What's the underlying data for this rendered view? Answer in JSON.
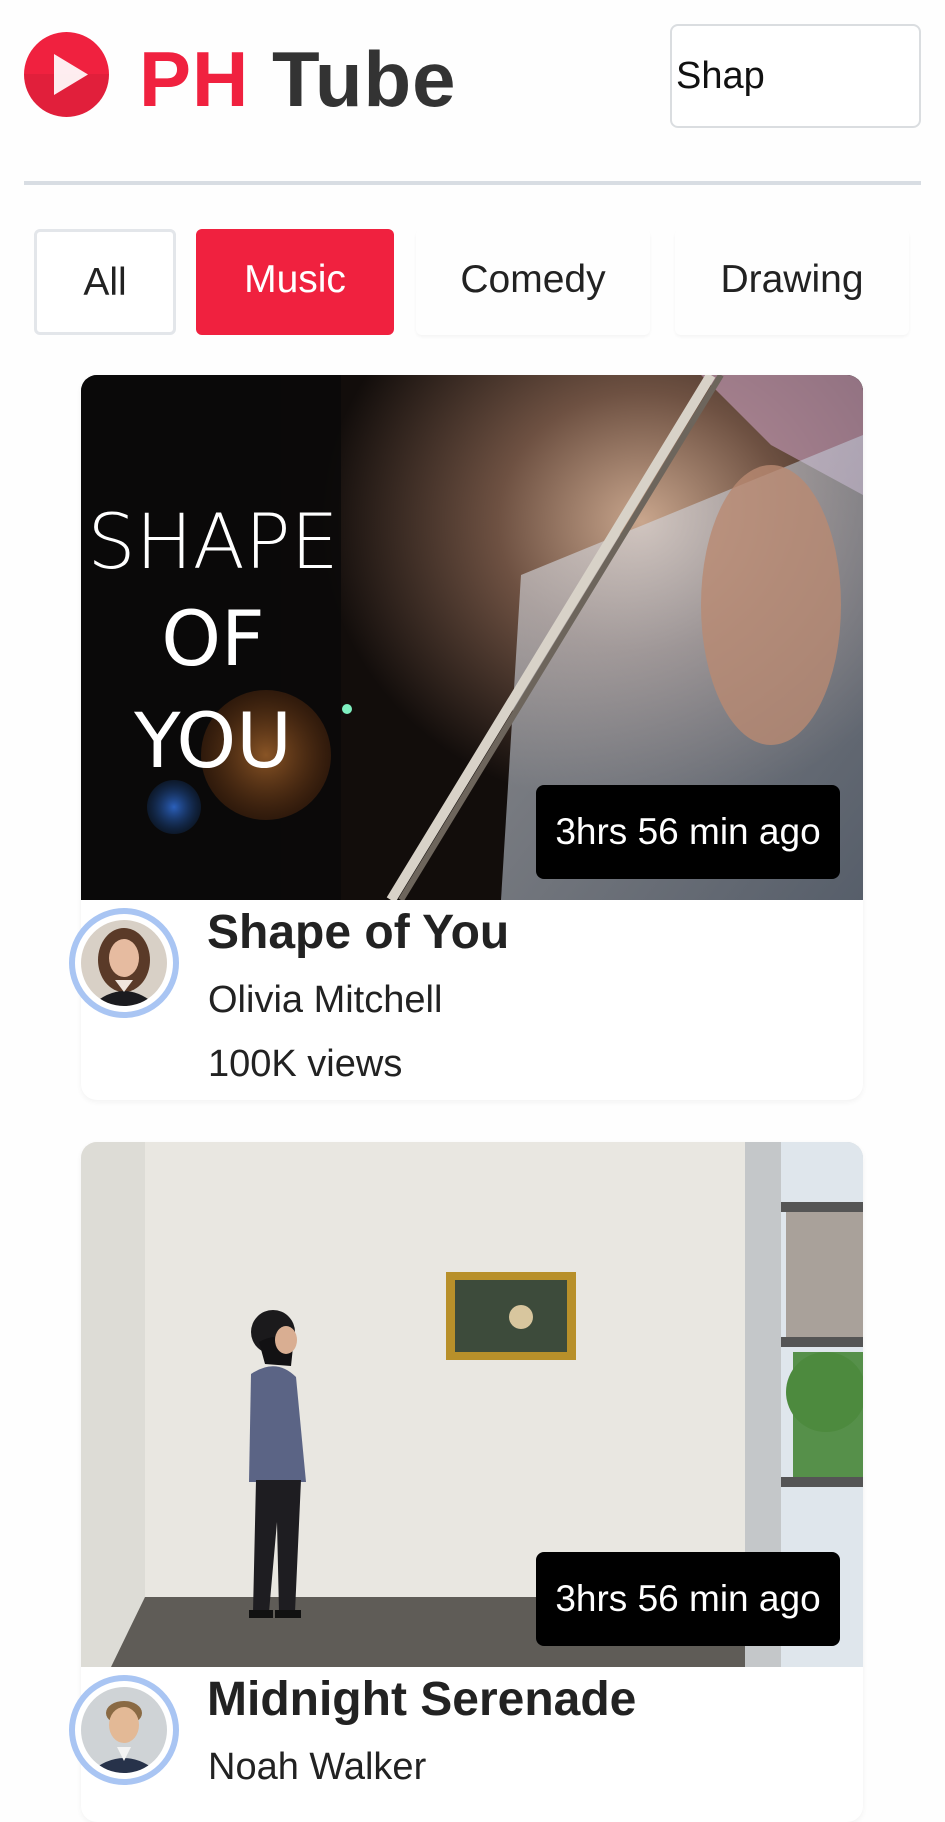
{
  "header": {
    "logo_brand": "PH",
    "logo_name": "Tube",
    "search_value": "Shap"
  },
  "categories": [
    {
      "label": "All",
      "active": false
    },
    {
      "label": "Music",
      "active": true
    },
    {
      "label": "Comedy",
      "active": false
    },
    {
      "label": "Drawing",
      "active": false
    }
  ],
  "videos": [
    {
      "title": "Shape of You",
      "channel": "Olivia Mitchell",
      "views": "100K views",
      "posted": "3hrs 56 min ago",
      "thumbnail_text": [
        "SHAPE",
        "OF",
        "YOU"
      ]
    },
    {
      "title": "Midnight Serenade",
      "channel": "Noah Walker",
      "views": "",
      "posted": "3hrs 56 min ago"
    }
  ],
  "colors": {
    "accent": "#f0213f",
    "text": "#222222",
    "avatar_ring": "#a9c5f3"
  }
}
